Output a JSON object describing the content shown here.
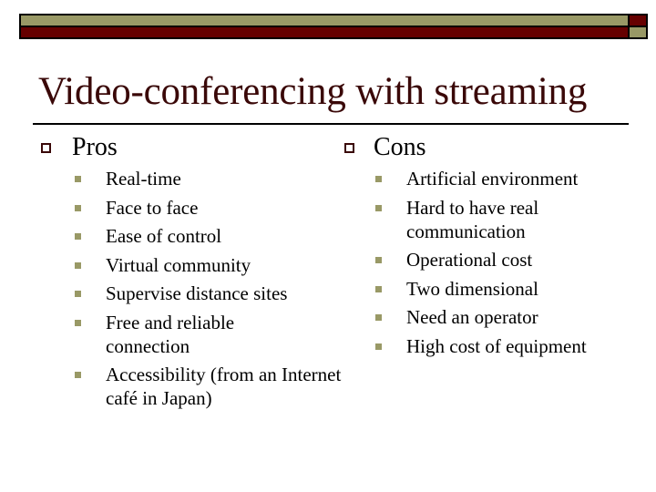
{
  "header": {
    "accent_colors": {
      "olive": "#999966",
      "dark_red": "#660000",
      "title_color": "#3a0808"
    }
  },
  "title": "Video-conferencing with streaming",
  "columns": [
    {
      "heading": "Pros",
      "items": [
        "Real-time",
        "Face to face",
        "Ease of control",
        "Virtual community",
        "Supervise distance sites",
        "Free and reliable connection",
        "Accessibility (from an Internet café in Japan)"
      ]
    },
    {
      "heading": "Cons",
      "items": [
        "Artificial environment",
        "Hard to have real communication",
        "Operational cost",
        "Two dimensional",
        "Need an operator",
        "High cost of equipment"
      ]
    }
  ],
  "icons": {
    "level1_bullet": "hollow-square",
    "level2_bullet": "filled-square"
  }
}
